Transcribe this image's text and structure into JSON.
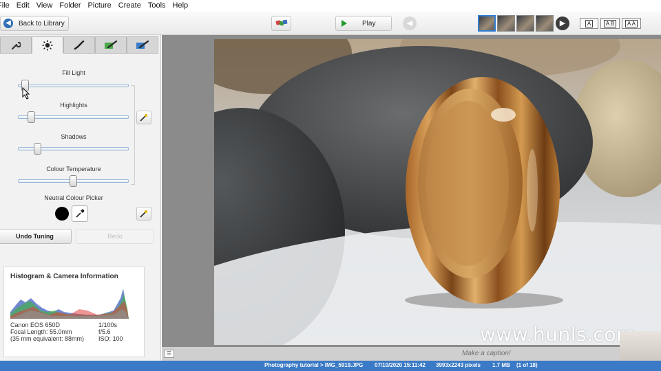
{
  "menu": [
    "File",
    "Edit",
    "View",
    "Folder",
    "Picture",
    "Create",
    "Tools",
    "Help"
  ],
  "toolbar": {
    "back_label": "Back to Library",
    "play_label": "Play",
    "view_buttons": [
      "A",
      "A B",
      "A A"
    ]
  },
  "tuning": {
    "sliders": [
      {
        "label": "Fill Light",
        "value": 0.03
      },
      {
        "label": "Highlights",
        "value": 0.09
      },
      {
        "label": "Shadows",
        "value": 0.15
      },
      {
        "label": "Colour Temperature",
        "value": 0.5
      }
    ],
    "neutral_label": "Neutral Colour Picker",
    "neutral_color": "#000000",
    "undo_label": "Undo Tuning",
    "redo_label": "Redo"
  },
  "histogram": {
    "title": "Histogram & Camera Information",
    "camera": "Canon EOS 650D",
    "focal": "Focal Length: 55.0mm",
    "equiv": "(35 mm equivalent:  88mm)",
    "shutter": "1/100s",
    "aperture": "f/5.6",
    "iso": "ISO: 100"
  },
  "caption": {
    "placeholder": "Make a caption!"
  },
  "watermark": "www.hunls.com",
  "status": {
    "path": "Photography tutorial > IMG_5919.JPG",
    "datetime": "07/10/2020 15:11:42",
    "dimensions": "3993x2243 pixels",
    "size": "1.7 MB",
    "position": "(1 of 18)"
  },
  "colors": {
    "accent": "#3a7ac6",
    "play_green": "#1e9b2c",
    "slider_track": "#9bb7d6"
  }
}
